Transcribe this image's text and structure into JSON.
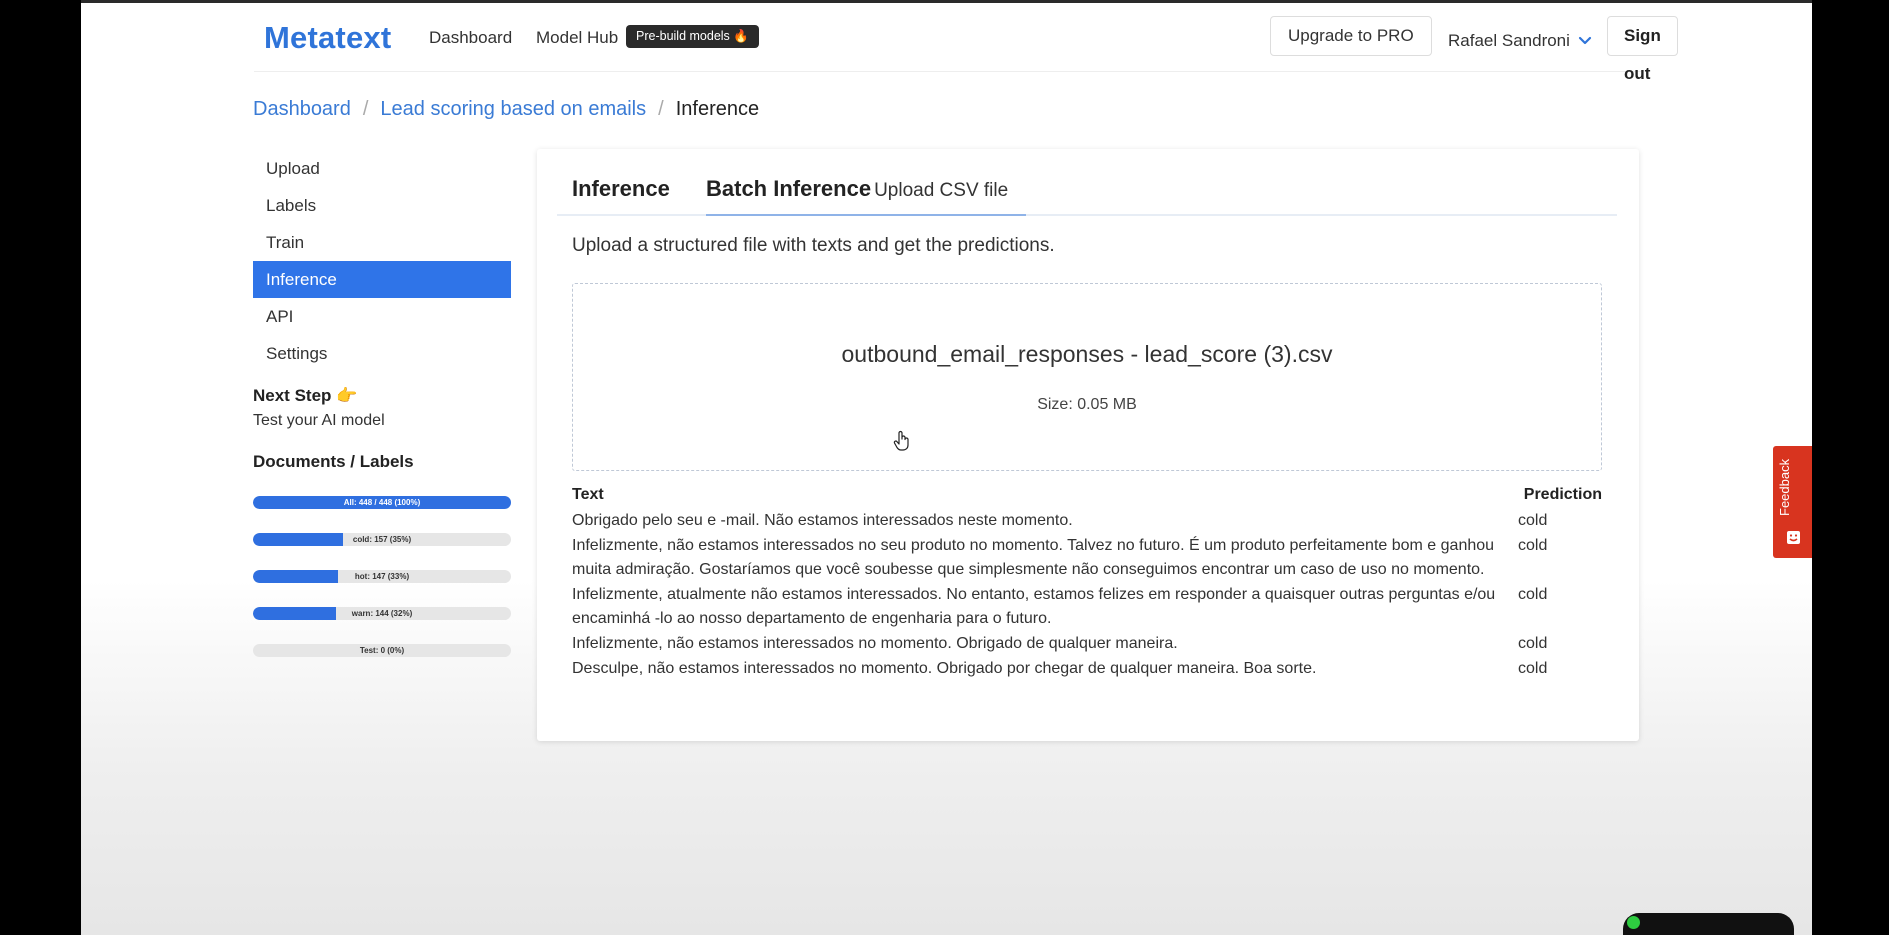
{
  "navbar": {
    "brand": "Metatext",
    "links": [
      "Dashboard",
      "Model Hub"
    ],
    "badge": "Pre-build models 🔥",
    "upgrade_label": "Upgrade to PRO",
    "user_name": "Rafael Sandroni",
    "signout_label": "Sign out"
  },
  "breadcrumb": {
    "items": [
      "Dashboard",
      "Lead scoring based on emails"
    ],
    "current": "Inference",
    "separator": "/"
  },
  "sidebar": {
    "items": [
      {
        "label": "Upload",
        "active": false
      },
      {
        "label": "Labels",
        "active": false
      },
      {
        "label": "Train",
        "active": false
      },
      {
        "label": "Inference",
        "active": true
      },
      {
        "label": "API",
        "active": false
      },
      {
        "label": "Settings",
        "active": false
      }
    ],
    "next_step_title": "Next Step 👉",
    "next_step_sub": "Test your AI model",
    "docs_title": "Documents / Labels",
    "progress": [
      {
        "label": "All: 448 / 448 (100%)",
        "fraction": 1.0
      },
      {
        "label": "cold: 157 (35%)",
        "fraction": 0.35
      },
      {
        "label": "hot: 147 (33%)",
        "fraction": 0.33
      },
      {
        "label": "warn: 144 (32%)",
        "fraction": 0.32
      },
      {
        "label": "Test: 0 (0%)",
        "fraction": 0.0
      }
    ]
  },
  "main": {
    "tabs": {
      "inference": "Inference",
      "batch": "Batch Inference",
      "batch_sub": "Upload CSV file"
    },
    "upload_description": "Upload a structured file with texts and get the predictions.",
    "file": {
      "name": "outbound_email_responses - lead_score (3).csv",
      "size": "Size: 0.05 MB"
    },
    "results": {
      "headers": {
        "text": "Text",
        "prediction": "Prediction"
      },
      "rows": [
        {
          "text": "Obrigado pelo seu e -mail. Não estamos interessados neste momento.",
          "prediction": "cold"
        },
        {
          "text": "Infelizmente, não estamos interessados no seu produto no momento. Talvez no futuro. É um produto perfeitamente bom e ganhou muita admiração. Gostaríamos que você soubesse que simplesmente não conseguimos encontrar um caso de uso no momento.",
          "prediction": "cold"
        },
        {
          "text": "Infelizmente, atualmente não estamos interessados. No entanto, estamos felizes em responder a quaisquer outras perguntas e/ou encaminhá -lo ao nosso departamento de engenharia para o futuro.",
          "prediction": "cold"
        },
        {
          "text": "Infelizmente, não estamos interessados no momento. Obrigado de qualquer maneira.",
          "prediction": "cold"
        },
        {
          "text": "Desculpe, não estamos interessados no momento. Obrigado por chegar de qualquer maneira. Boa sorte.",
          "prediction": "cold"
        }
      ]
    }
  },
  "feedback": {
    "label": "Feedback"
  },
  "colors": {
    "brand": "#2f74d9",
    "accent": "#2f74e8",
    "feedback": "#d8341f"
  }
}
